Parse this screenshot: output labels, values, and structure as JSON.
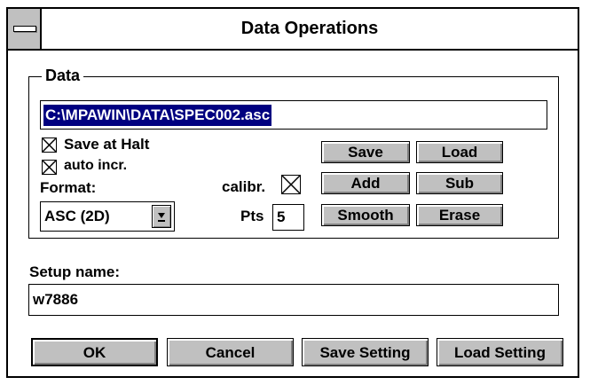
{
  "window": {
    "title": "Data Operations"
  },
  "data_group": {
    "label": "Data",
    "path": "C:\\MPAWIN\\DATA\\SPEC002.asc",
    "save_at_halt": {
      "label": "Save at Halt",
      "checked": true
    },
    "auto_incr": {
      "label": "auto incr.",
      "checked": true
    },
    "format_label": "Format:",
    "format_value": "ASC (2D)",
    "calibr_label": "calibr.",
    "calibr_checked": true,
    "pts_label": "Pts",
    "pts_value": "5",
    "buttons": {
      "save": "Save",
      "load": "Load",
      "add": "Add",
      "sub": "Sub",
      "smooth": "Smooth",
      "erase": "Erase"
    }
  },
  "setup": {
    "label": "Setup name:",
    "value": "w7886"
  },
  "footer": {
    "ok": "OK",
    "cancel": "Cancel",
    "save_setting": "Save Setting",
    "load_setting": "Load Setting"
  },
  "icons": {
    "system_menu": "system-menu-icon",
    "dropdown": "dropdown-arrow-icon",
    "check": "checkbox-x-icon"
  }
}
